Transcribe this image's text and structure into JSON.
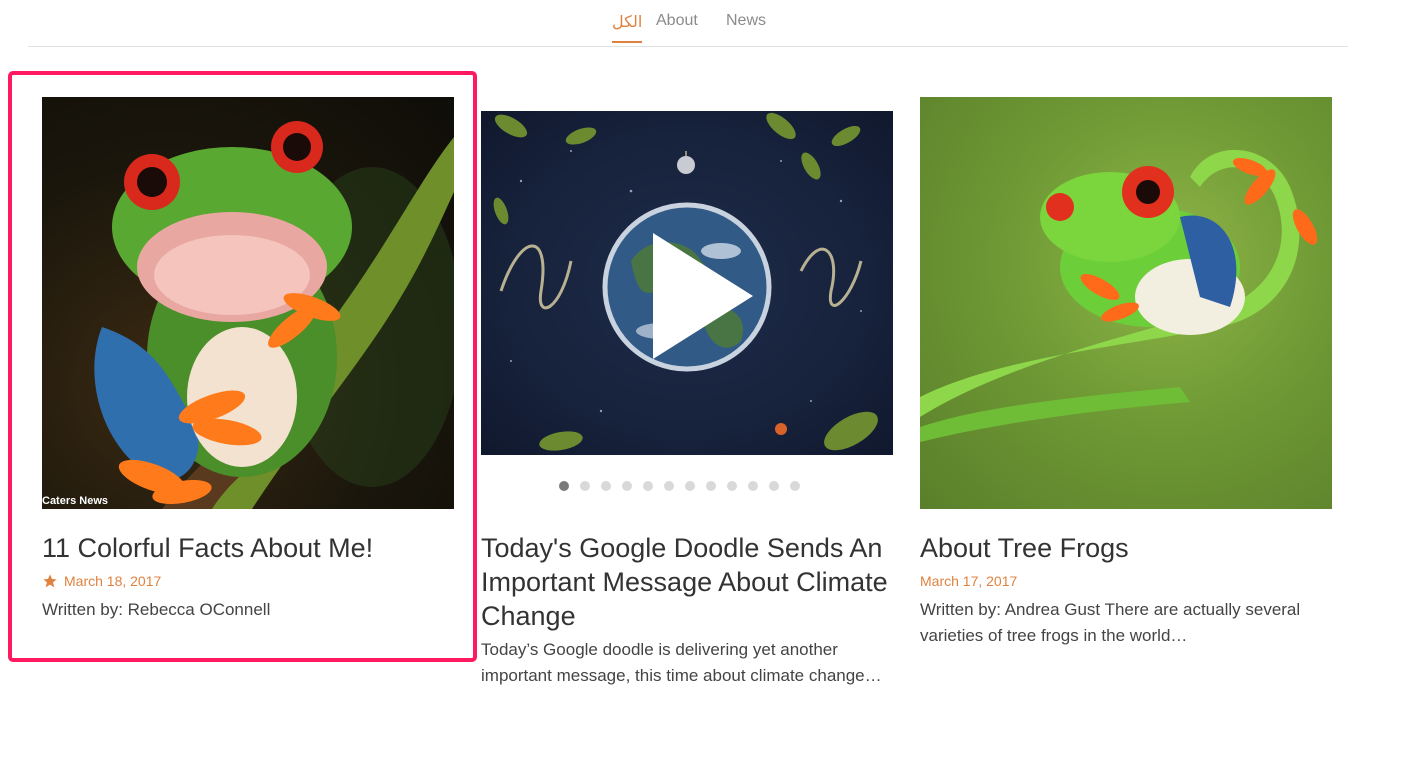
{
  "tabs": [
    {
      "label": "الكل",
      "active": true
    },
    {
      "label": "About",
      "active": false
    },
    {
      "label": "News",
      "active": false
    }
  ],
  "colors": {
    "accent": "#e0823f",
    "highlight": "#ff1960"
  },
  "cards": [
    {
      "title": "11 Colorful Facts About Me!",
      "date": "March 18, 2017",
      "featured_icon": "star-icon",
      "excerpt": "Written by: Rebecca OConnell",
      "image_caption": "Caters News"
    },
    {
      "title": "Today's Google Doodle Sends An Important Message About Climate Change",
      "excerpt": "Today’s Google doodle is delivering yet another important message, this time about climate change…",
      "media_icon": "play-icon",
      "slide_dots": 12,
      "active_dot": 0
    },
    {
      "title": "About Tree Frogs",
      "date": "March 17, 2017",
      "excerpt": "Written by: Andrea Gust There are actually several varieties of tree frogs in the world…"
    }
  ]
}
